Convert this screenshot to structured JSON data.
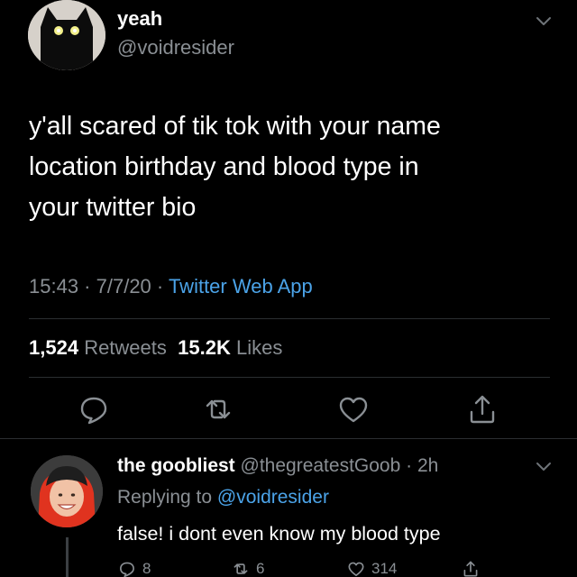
{
  "tweet": {
    "display_name": "yeah",
    "handle": "@voidresider",
    "text": "y'all scared of tik tok with your name\nlocation birthday and blood type in\nyour twitter bio",
    "time": "15:43",
    "separator": " · ",
    "date": "7/7/20",
    "source": "Twitter Web App",
    "retweets_count": "1,524",
    "retweets_label": "Retweets",
    "likes_count": "15.2K",
    "likes_label": "Likes"
  },
  "reply": {
    "display_name": "the goobliest",
    "handle": "@thegreatestGoob",
    "age": "2h",
    "replying_prefix": "Replying to ",
    "replying_to": "@voidresider",
    "text": "false! i dont even know my blood type",
    "reply_count": "8",
    "retweet_count": "6",
    "like_count": "314"
  },
  "colors": {
    "background": "#000000",
    "primary_text": "#ffffff",
    "secondary_text": "#8a8f94",
    "link": "#4ba3e8",
    "divider": "#2b2e31"
  },
  "icons": {
    "main_menu": "chevron-down-icon",
    "reply": "comment-icon",
    "retweet": "retweet-icon",
    "like": "heart-icon",
    "share": "share-icon"
  }
}
